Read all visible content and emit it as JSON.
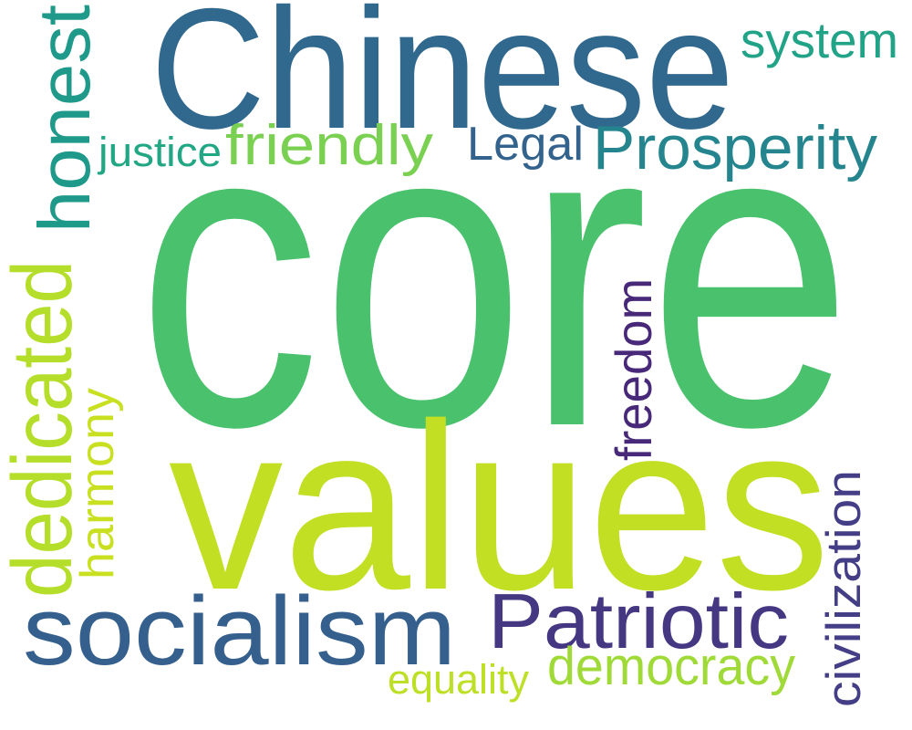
{
  "words": [
    {
      "text": "Chinese",
      "color": "#31688e"
    },
    {
      "text": "system",
      "color": "#20a386"
    },
    {
      "text": "honest",
      "color": "#1f9a8a"
    },
    {
      "text": "justice",
      "color": "#22a785"
    },
    {
      "text": "friendly",
      "color": "#7ad151"
    },
    {
      "text": "Legal",
      "color": "#33638d"
    },
    {
      "text": "Prosperity",
      "color": "#25858e"
    },
    {
      "text": "core",
      "color": "#4ac16d"
    },
    {
      "text": "values",
      "color": "#c2df23"
    },
    {
      "text": "dedicated",
      "color": "#b5de2b"
    },
    {
      "text": "harmony",
      "color": "#c8e020"
    },
    {
      "text": "freedom",
      "color": "#482878"
    },
    {
      "text": "civilization",
      "color": "#433e85"
    },
    {
      "text": "socialism",
      "color": "#355f8d"
    },
    {
      "text": "Patriotic",
      "color": "#453781"
    },
    {
      "text": "democracy",
      "color": "#a0da39"
    },
    {
      "text": "equality",
      "color": "#bddf26"
    }
  ]
}
